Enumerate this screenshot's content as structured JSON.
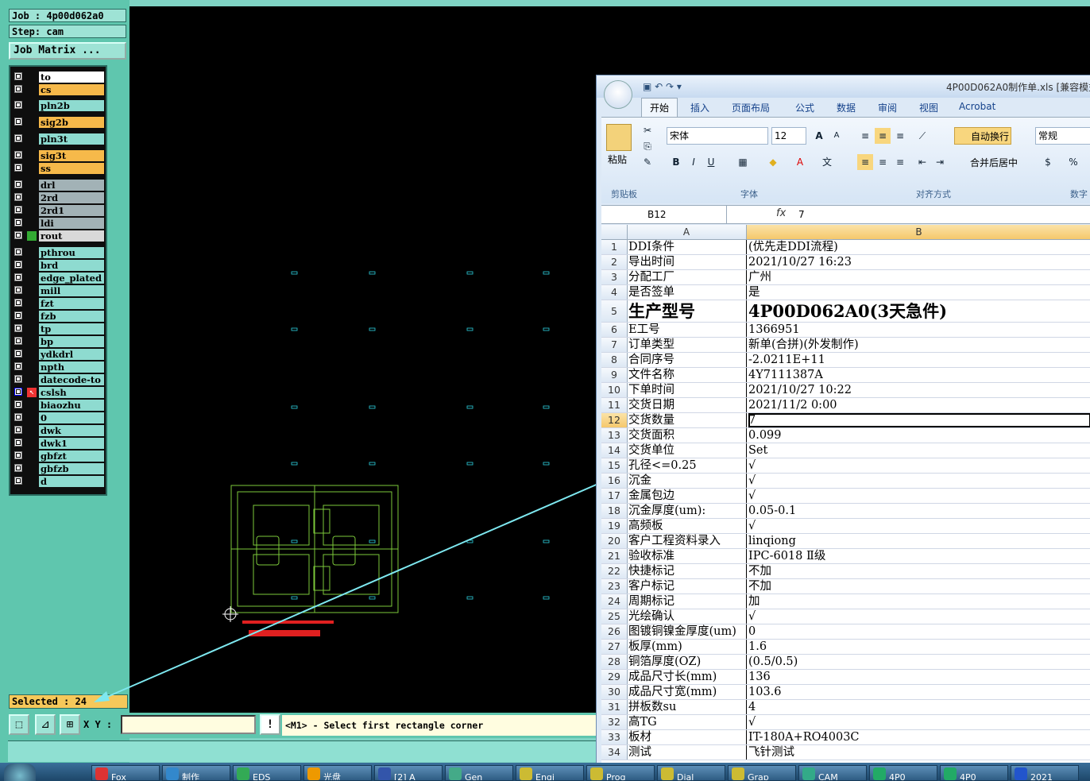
{
  "cam": {
    "job_label": "Job : 4p00d062a0",
    "step_label": "Step: cam",
    "job_matrix_button": "Job Matrix ...",
    "selected_label": "Selected : 24",
    "xy_label": "X Y :",
    "xy_input_value": "",
    "exclaim_label": "!",
    "prompt": "<M1> - Select first rectangle corner",
    "layers": [
      {
        "name": "to",
        "color": "white"
      },
      {
        "name": "cs",
        "color": "orange"
      },
      {
        "name": "pln2b",
        "color": "cyan"
      },
      {
        "name": "sig2b",
        "color": "orange"
      },
      {
        "name": "pln3t",
        "color": "cyan"
      },
      {
        "name": "sig3t",
        "color": "orange"
      },
      {
        "name": "ss",
        "color": "orange"
      },
      {
        "name": "drl",
        "color": "gray"
      },
      {
        "name": "2rd",
        "color": "gray"
      },
      {
        "name": "2rd1",
        "color": "gray"
      },
      {
        "name": "ldi",
        "color": "gray"
      },
      {
        "name": "rout",
        "color": "lightgray"
      },
      {
        "name": "pthrou",
        "color": "cyan"
      },
      {
        "name": "brd",
        "color": "cyan"
      },
      {
        "name": "edge_plated",
        "color": "cyan"
      },
      {
        "name": "mill",
        "color": "cyan"
      },
      {
        "name": "fzt",
        "color": "cyan"
      },
      {
        "name": "fzb",
        "color": "cyan"
      },
      {
        "name": "tp",
        "color": "cyan"
      },
      {
        "name": "bp",
        "color": "cyan"
      },
      {
        "name": "ydkdrl",
        "color": "cyan"
      },
      {
        "name": "npth",
        "color": "cyan"
      },
      {
        "name": "datecode-to",
        "color": "cyan"
      },
      {
        "name": "cslsh",
        "color": "cyan"
      },
      {
        "name": "biaozhu",
        "color": "cyan"
      },
      {
        "name": "0",
        "color": "cyan"
      },
      {
        "name": "dwk",
        "color": "cyan"
      },
      {
        "name": "dwk1",
        "color": "cyan"
      },
      {
        "name": "gbfzt",
        "color": "cyan"
      },
      {
        "name": "gbfzb",
        "color": "cyan"
      },
      {
        "name": "d",
        "color": "cyan"
      }
    ]
  },
  "excel": {
    "title": "4P00D062A0制作单.xls [兼容模式",
    "tabs": [
      "开始",
      "插入",
      "页面布局",
      "公式",
      "数据",
      "审阅",
      "视图",
      "Acrobat"
    ],
    "ribbon": {
      "paste_label": "粘贴",
      "clipboard_group": "剪贴板",
      "font_name": "宋体",
      "font_size": "12",
      "font_group": "字体",
      "wrap_text": "自动换行",
      "merge_center": "合并后居中",
      "align_group": "对齐方式",
      "number_format": "常规",
      "number_group": "数字"
    },
    "name_box": "B12",
    "fx": "fx",
    "formula_value": "7",
    "columns": [
      "A",
      "B"
    ],
    "rows": [
      {
        "n": "1",
        "a": "DDI条件",
        "b": "(优先走DDI流程)"
      },
      {
        "n": "2",
        "a": "导出时间",
        "b": "2021/10/27 16:23"
      },
      {
        "n": "3",
        "a": "分配工厂",
        "b": "广州"
      },
      {
        "n": "4",
        "a": "是否签单",
        "b": "是"
      },
      {
        "n": "5",
        "a": "生产型号",
        "b": "4P00D062A0(3天急件)"
      },
      {
        "n": "6",
        "a": "E工号",
        "b": "1366951"
      },
      {
        "n": "7",
        "a": "订单类型",
        "b": "新单(合拼)(外发制作)"
      },
      {
        "n": "8",
        "a": "合同序号",
        "b": "-2.0211E+11"
      },
      {
        "n": "9",
        "a": "文件名称",
        "b": "4Y7111387A"
      },
      {
        "n": "10",
        "a": "下单时间",
        "b": "2021/10/27 10:22"
      },
      {
        "n": "11",
        "a": "交货日期",
        "b": "2021/11/2 0:00"
      },
      {
        "n": "12",
        "a": "交货数量",
        "b": "7"
      },
      {
        "n": "13",
        "a": "交货面积",
        "b": "0.099"
      },
      {
        "n": "14",
        "a": "交货单位",
        "b": "Set"
      },
      {
        "n": "15",
        "a": "孔径<=0.25",
        "b": "√"
      },
      {
        "n": "16",
        "a": "沉金",
        "b": "√"
      },
      {
        "n": "17",
        "a": "金属包边",
        "b": "√"
      },
      {
        "n": "18",
        "a": "沉金厚度(um):",
        "b": "0.05-0.1"
      },
      {
        "n": "19",
        "a": "高频板",
        "b": "√"
      },
      {
        "n": "20",
        "a": "客户工程资料录入",
        "b": "linqiong"
      },
      {
        "n": "21",
        "a": "验收标准",
        "b": "IPC-6018 Ⅱ级"
      },
      {
        "n": "22",
        "a": "快捷标记",
        "b": "不加"
      },
      {
        "n": "23",
        "a": "客户标记",
        "b": "不加"
      },
      {
        "n": "24",
        "a": "周期标记",
        "b": "加"
      },
      {
        "n": "25",
        "a": "光绘确认",
        "b": "√"
      },
      {
        "n": "26",
        "a": "图镀铜镍金厚度(um)",
        "b": "0"
      },
      {
        "n": "27",
        "a": "板厚(mm)",
        "b": "1.6"
      },
      {
        "n": "28",
        "a": "铜箔厚度(OZ)",
        "b": "(0.5/0.5)"
      },
      {
        "n": "29",
        "a": "成品尺寸长(mm)",
        "b": "136"
      },
      {
        "n": "30",
        "a": "成品尺寸宽(mm)",
        "b": "103.6"
      },
      {
        "n": "31",
        "a": "拼板数su",
        "b": "4"
      },
      {
        "n": "32",
        "a": "高TG",
        "b": "√"
      },
      {
        "n": "33",
        "a": "板材",
        "b": "IT-180A+RO4003C"
      },
      {
        "n": "34",
        "a": "测试",
        "b": "飞针测试"
      }
    ]
  },
  "taskbar": {
    "items": [
      "Fox",
      "制作",
      "EDS",
      "光盘",
      "[2] A",
      "Gen",
      "Engi",
      "Prog",
      "Dial",
      "Grap",
      "CAM",
      "4P0",
      "4P0",
      "2021"
    ]
  },
  "colors": {
    "canvas": "#000000",
    "panel": "#5fc6ae",
    "selected_bg": "#f6c85a",
    "arrow": "#7ee8f0"
  }
}
